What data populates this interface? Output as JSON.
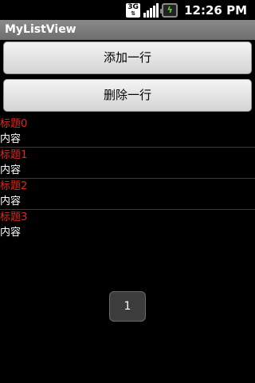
{
  "status_bar": {
    "network_type": "3G",
    "clock": "12:26 PM"
  },
  "app": {
    "title": "MyListView"
  },
  "buttons": {
    "add_row": "添加一行",
    "delete_row": "删除一行"
  },
  "list": {
    "items": [
      {
        "title": "标题0",
        "content": "内容"
      },
      {
        "title": "标题1",
        "content": "内容"
      },
      {
        "title": "标题2",
        "content": "内容"
      },
      {
        "title": "标题3",
        "content": "内容"
      }
    ]
  },
  "pager": {
    "current_page": "1"
  },
  "colors": {
    "item_title": "#e0281e",
    "battery_bolt": "#5fd02a"
  }
}
